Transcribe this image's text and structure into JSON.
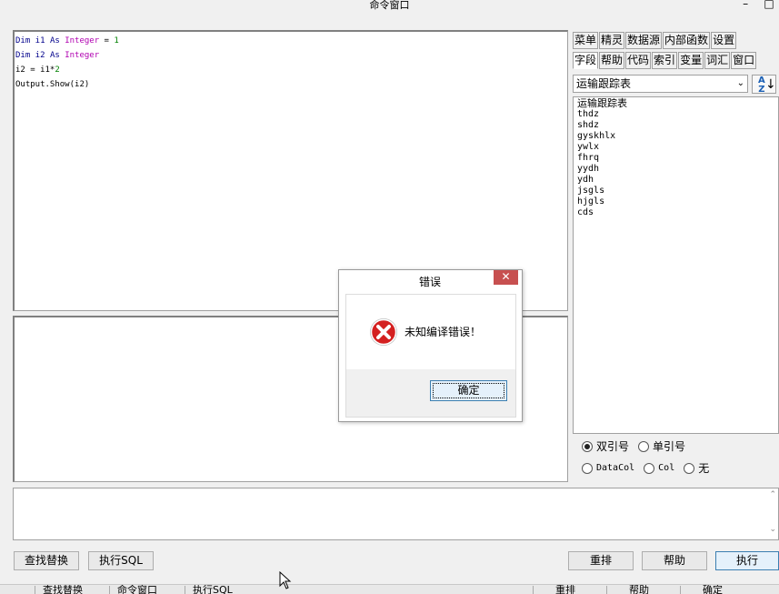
{
  "window": {
    "title": "命令窗口",
    "minimize": "–",
    "maximize": "□"
  },
  "code": {
    "lines": [
      [
        {
          "t": "Dim i1 ",
          "c": "kw"
        },
        {
          "t": "As ",
          "c": "kw"
        },
        {
          "t": "Integer",
          "c": "ty"
        },
        {
          "t": " = ",
          "c": ""
        },
        {
          "t": "1",
          "c": "num"
        }
      ],
      [
        {
          "t": "Dim i2 ",
          "c": "kw"
        },
        {
          "t": "As ",
          "c": "kw"
        },
        {
          "t": "Integer",
          "c": "ty"
        }
      ],
      [
        {
          "t": "i2 = i1*",
          "c": ""
        },
        {
          "t": "2",
          "c": "num"
        }
      ],
      [
        {
          "t": "Output.Show(i2)",
          "c": ""
        }
      ]
    ]
  },
  "tabs_row1": [
    "菜单",
    "精灵",
    "数据源",
    "内部函数",
    "设置"
  ],
  "tabs_row2": [
    "字段",
    "帮助",
    "代码",
    "索引",
    "变量",
    "词汇",
    "窗口"
  ],
  "table_select": {
    "value": "运输跟踪表"
  },
  "sort_button": {
    "top": "A",
    "bottom": "Z",
    "arrow": "↓"
  },
  "fields": [
    "运输跟踪表",
    "thdz",
    "shdz",
    "gyskhlx",
    "ywlx",
    "fhrq",
    "yydh",
    "ydh",
    "jsgls",
    "hjgls",
    "cds"
  ],
  "quote_options": {
    "double": "双引号",
    "single": "单引号"
  },
  "col_options": {
    "datacol": "DataCol",
    "col": "Col",
    "none": "无"
  },
  "buttons": {
    "find_replace": "查找替换",
    "exec_sql": "执行SQL",
    "rearrange": "重排",
    "help": "帮助",
    "execute": "执行"
  },
  "taskbar": [
    "查找替换",
    "命令窗口",
    "执行SQL",
    "重排",
    "帮助",
    "确定"
  ],
  "dialog": {
    "title": "错误",
    "close": "✕",
    "message": "未知编译错误！",
    "ok": "确定"
  },
  "colors": {
    "keyword": "#00008b",
    "type": "#b000b0",
    "number": "#008000",
    "error_red": "#d22",
    "close_red": "#c75050"
  }
}
